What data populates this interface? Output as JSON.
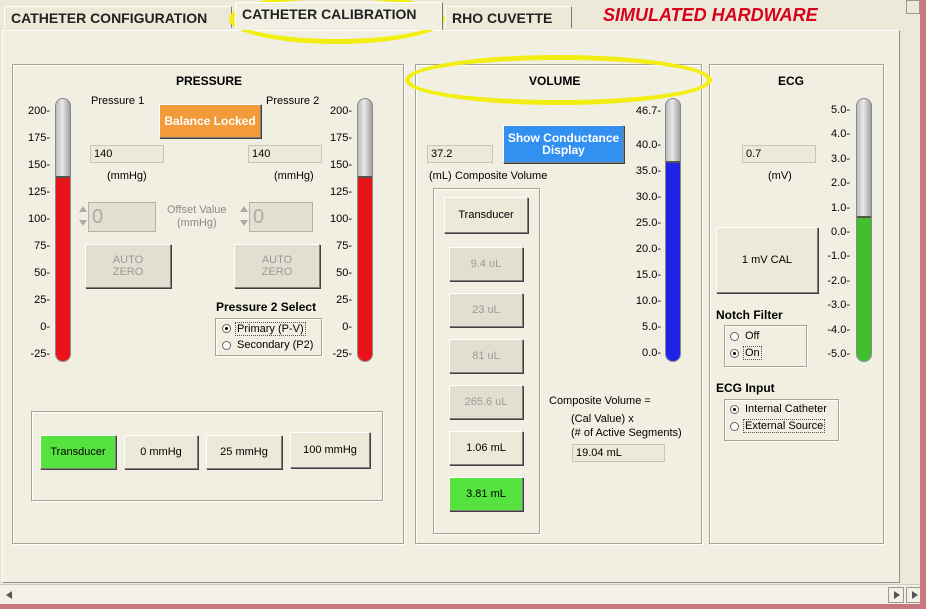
{
  "tabs": [
    {
      "label": "CATHETER CONFIGURATION"
    },
    {
      "label": "CATHETER CALIBRATION"
    },
    {
      "label": "RHO CUVETTE"
    }
  ],
  "banner": "SIMULATED HARDWARE",
  "pressure": {
    "title": "PRESSURE",
    "p1_label": "Pressure 1",
    "p2_label": "Pressure 2",
    "balance_label": "Balance Locked",
    "p1_value": "140",
    "p2_value": "140",
    "p1_unit": "(mmHg)",
    "p2_unit": "(mmHg)",
    "offset1": "0",
    "offset2": "0",
    "offset_label_1": "Offset Value",
    "offset_label_2": "(mmHg)",
    "autozero1_line1": "AUTO",
    "autozero1_line2": "ZERO",
    "autozero2_line1": "AUTO",
    "autozero2_line2": "ZERO",
    "ticks": [
      "200",
      "175",
      "150",
      "125",
      "100",
      "75",
      "50",
      "25",
      "0",
      "-25"
    ],
    "scale_min": -25,
    "scale_max": 200,
    "p1_level": 140,
    "p2_level": 140,
    "select_title": "Pressure 2 Select",
    "select_options": [
      "Primary (P-V)",
      "Secondary (P2)"
    ],
    "buttons": [
      "Transducer",
      "0 mmHg",
      "25 mmHg",
      "100 mmHg"
    ]
  },
  "volume": {
    "title": "VOLUME",
    "value": "37.2",
    "unit_label": "(mL)",
    "comp_label": "Composite Volume",
    "show_conductance": "Show Conductance Display",
    "buttons": [
      "Transducer",
      "9.4 uL",
      "23 uL",
      "81 uL",
      "265.6 uL",
      "1.06 mL",
      "3.81 mL"
    ],
    "ticks": [
      "46.7",
      "40.0",
      "35.0",
      "30.0",
      "25.0",
      "20.0",
      "15.0",
      "10.0",
      "5.0",
      "0.0"
    ],
    "scale_min": 0,
    "scale_max": 46.7,
    "level": 37.2,
    "formula_1": "Composite Volume =",
    "formula_2": "(Cal Value)  x",
    "formula_3": "(# of Active Segments)",
    "composite_result": "19.04 mL"
  },
  "ecg": {
    "title": "ECG",
    "value": "0.7",
    "unit": "(mV)",
    "cal_button": "1 mV CAL",
    "ticks": [
      "5.0",
      "4.0",
      "3.0",
      "2.0",
      "1.0",
      "0.0",
      "-1.0",
      "-2.0",
      "-3.0",
      "-4.0",
      "-5.0"
    ],
    "scale_min": -5,
    "scale_max": 5,
    "level": 0.7,
    "notch_title": "Notch Filter",
    "notch_options": [
      "Off",
      "On"
    ],
    "input_title": "ECG Input",
    "input_options": [
      "Internal Catheter",
      "External Source"
    ]
  },
  "colors": {
    "pressure_fill": "#e8141a",
    "volume_fill": "#1c24e6",
    "ecg_fill": "#3fbf2e",
    "green_btn": "#56e23f",
    "highlight": "#f2ee12"
  }
}
